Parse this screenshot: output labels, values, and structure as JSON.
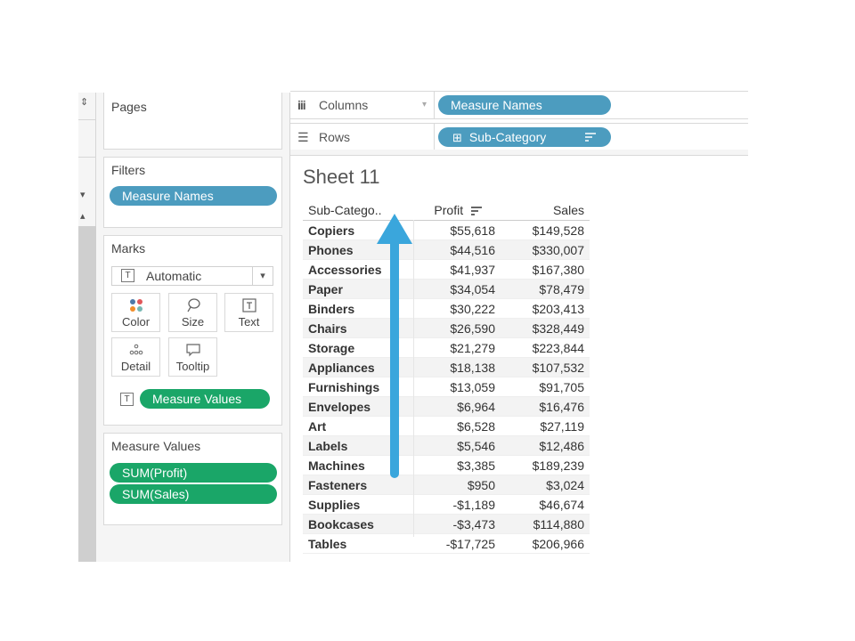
{
  "left_strip": {
    "sort_glyph": "⇕",
    "dropdown_glyph": "▾",
    "collapse_glyph": "▴"
  },
  "pages": {
    "title": "Pages"
  },
  "filters": {
    "title": "Filters",
    "pills": [
      "Measure Names"
    ]
  },
  "marks": {
    "title": "Marks",
    "mark_type": "Automatic",
    "mark_type_icon": "T",
    "buttons": [
      {
        "name": "color",
        "label": "Color",
        "icon": "color-dots-icon"
      },
      {
        "name": "size",
        "label": "Size",
        "icon": "size-lasso-icon"
      },
      {
        "name": "text",
        "label": "Text",
        "icon": "text-box-icon"
      },
      {
        "name": "detail",
        "label": "Detail",
        "icon": "detail-dots-icon"
      },
      {
        "name": "tooltip",
        "label": "Tooltip",
        "icon": "speech-bubble-icon"
      }
    ],
    "text_field_icon": "T",
    "text_field_pill": "Measure Values"
  },
  "measure_values": {
    "title": "Measure Values",
    "pills": [
      "SUM(Profit)",
      "SUM(Sales)"
    ]
  },
  "columns_shelf": {
    "label": "Columns",
    "icon": "iii",
    "pill": "Measure Names"
  },
  "rows_shelf": {
    "label": "Rows",
    "icon": "☰",
    "pill": "Sub-Category",
    "pill_expand": "⊞",
    "pill_sort": "⇅"
  },
  "sheet": {
    "title": "Sheet 11"
  },
  "table": {
    "headers": [
      "Sub-Catego..",
      "Profit",
      "Sales"
    ],
    "rows": [
      [
        "Copiers",
        "$55,618",
        "$149,528"
      ],
      [
        "Phones",
        "$44,516",
        "$330,007"
      ],
      [
        "Accessories",
        "$41,937",
        "$167,380"
      ],
      [
        "Paper",
        "$34,054",
        "$78,479"
      ],
      [
        "Binders",
        "$30,222",
        "$203,413"
      ],
      [
        "Chairs",
        "$26,590",
        "$328,449"
      ],
      [
        "Storage",
        "$21,279",
        "$223,844"
      ],
      [
        "Appliances",
        "$18,138",
        "$107,532"
      ],
      [
        "Furnishings",
        "$13,059",
        "$91,705"
      ],
      [
        "Envelopes",
        "$6,964",
        "$16,476"
      ],
      [
        "Art",
        "$6,528",
        "$27,119"
      ],
      [
        "Labels",
        "$5,546",
        "$12,486"
      ],
      [
        "Machines",
        "$3,385",
        "$189,239"
      ],
      [
        "Fasteners",
        "$950",
        "$3,024"
      ],
      [
        "Supplies",
        "-$1,189",
        "$46,674"
      ],
      [
        "Bookcases",
        "-$3,473",
        "$114,880"
      ],
      [
        "Tables",
        "-$17,725",
        "$206,966"
      ]
    ]
  },
  "annotation": {
    "type": "up-arrow",
    "color": "#3aa6dc"
  },
  "colors": {
    "dimension_pill": "#4c9cbf",
    "measure_pill": "#1aa668",
    "arrow": "#3aa6dc"
  }
}
